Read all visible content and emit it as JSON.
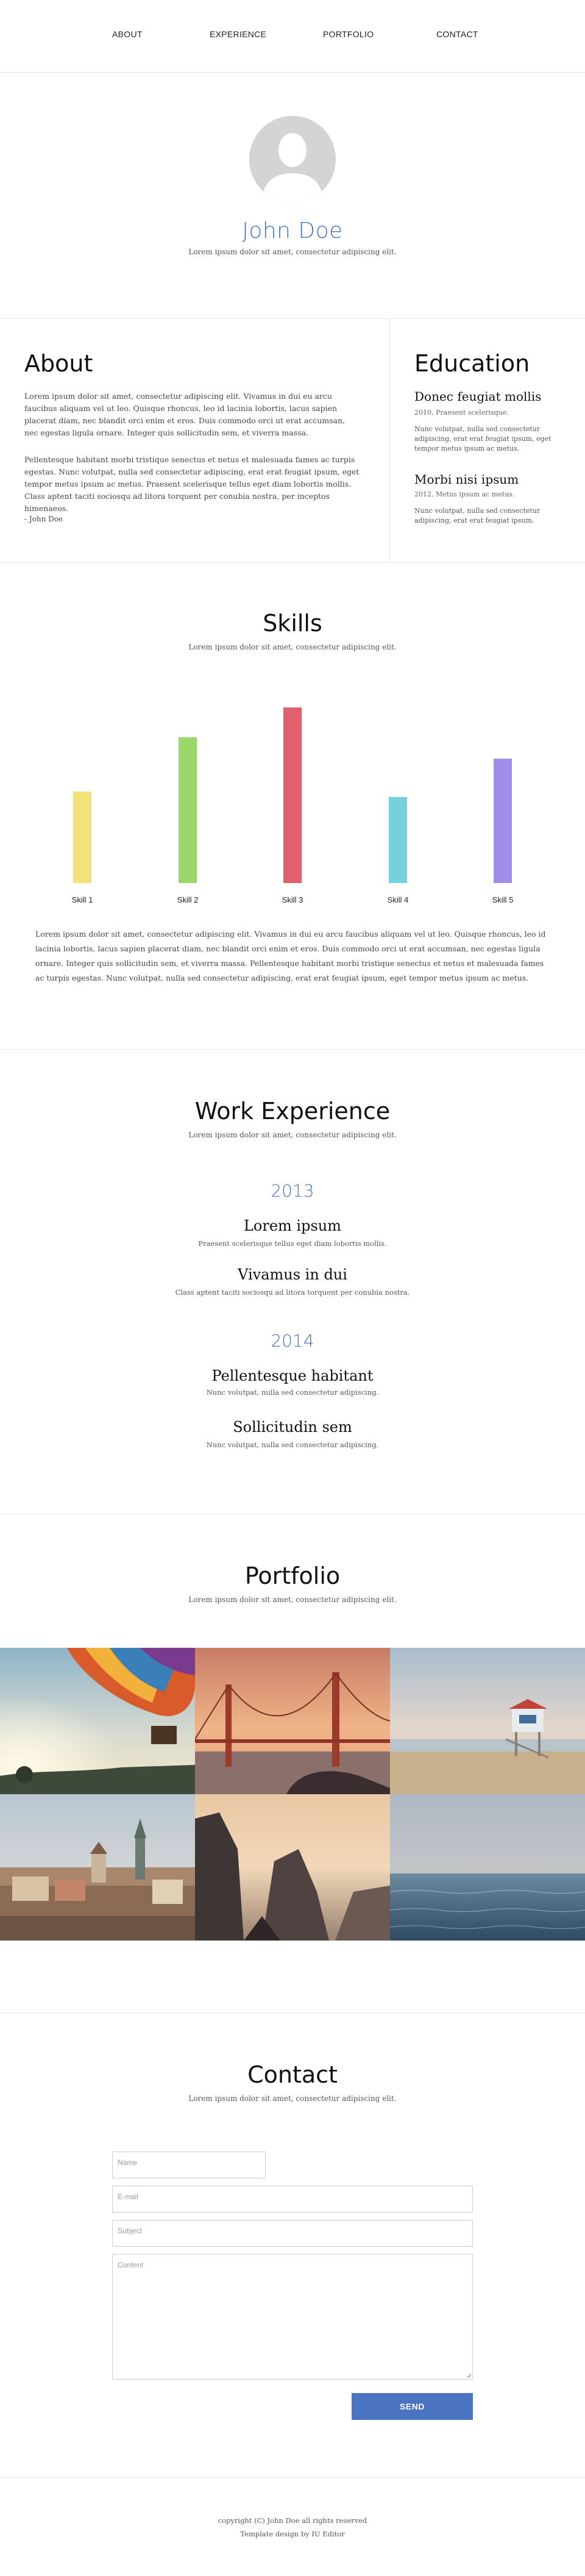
{
  "nav": {
    "items": [
      {
        "label": "ABOUT"
      },
      {
        "label": "EXPERIENCE"
      },
      {
        "label": "PORTFOLIO"
      },
      {
        "label": "CONTACT"
      }
    ]
  },
  "hero": {
    "name": "John Doe",
    "tagline": "Lorem ipsum dolor sit amet, consectetur adipiscing elit."
  },
  "about": {
    "title": "About",
    "paragraphs": [
      "Lorem ipsum dolor sit amet, consectetur adipiscing elit. Vivamus in dui eu arcu faucibus aliquam vel ut leo. Quisque rhoncus, leo id lacinia lobortis, lacus sapien placerat diam, nec blandit orci enim et eros. Duis commodo orci ut erat accumsan, nec egestas ligula ornare. Integer quis sollicitudin sem, et viverra massa.",
      "Pellentesque habitant morbi tristique senectus et netus et malesuada fames ac turpis egestas. Nunc volutpat, nulla sed consectetur adipiscing, erat erat feugiat ipsum, eget tempor metus ipsum ac metus. Praesent scelerisque tellus eget diam lobortis mollis. Class aptent taciti sociosqu ad litora torquent per conubia nostra, per inceptos himenaeos."
    ],
    "signature": "- John Doe"
  },
  "education": {
    "title": "Education",
    "items": [
      {
        "heading": "Donec feugiat mollis",
        "meta": "2010, Praesent scelerisque.",
        "text": "Nunc volutpat, nulla sed consectetur adipiscing, erat erat feugiat ipsum, eget tempor metus ipsum ac metus."
      },
      {
        "heading": "Morbi nisi ipsum",
        "meta": "2012, Metus ipsum ac metus.",
        "text": "Nunc volutpat, nulla sed consectetur adipiscing, erat erat feugiat ipsum."
      }
    ]
  },
  "skills": {
    "title": "Skills",
    "subtitle": "Lorem ipsum dolor sit amet, consectetur adipiscing elit.",
    "paragraph": "Lorem ipsum dolor sit amet, consectetur adipiscing elit. Vivamus in dui eu arcu faucibus aliquam vel ut leo. Quisque rhoncus, leo id lacinia lobortis, lacus sapien placerat diam, nec blandit orci enim et eros. Duis commodo orci ut erat accumsan, nec egestas ligula ornare. Integer quis sollicitudin sem, et viverra massa. Pellentesque habitant morbi tristique senectus et netus et malesuada fames ac turpis egestas. Nunc volutpat, nulla sed consectetur adipiscing, erat erat feugiat ipsum, eget tempor metus ipsum ac metus.",
    "items": [
      {
        "label": "Skill 1",
        "level": 0.52,
        "color": "#f2e27a"
      },
      {
        "label": "Skill 2",
        "level": 0.83,
        "color": "#9ad86a"
      },
      {
        "label": "Skill 3",
        "level": 1.0,
        "color": "#e4606e"
      },
      {
        "label": "Skill 4",
        "level": 0.49,
        "color": "#74d2e0"
      },
      {
        "label": "Skill 5",
        "level": 0.71,
        "color": "#a28ee8"
      }
    ]
  },
  "work": {
    "title": "Work Experience",
    "subtitle": "Lorem ipsum dolor sit amet, consectetur adipiscing elit.",
    "years": [
      {
        "year": "2013",
        "jobs": [
          {
            "title": "Lorem ipsum",
            "desc": "Praesent scelerisque tellus eget diam lobortis mollis."
          },
          {
            "title": "Vivamus in dui",
            "desc": "Class aptent taciti sociosqu ad litora torquent per conubia nostra."
          }
        ]
      },
      {
        "year": "2014",
        "jobs": [
          {
            "title": "Pellentesque habitant",
            "desc": "Nunc volutpat, nulla sed consectetur adipiscing."
          },
          {
            "title": "Sollicitudin sem",
            "desc": "Nunc volutpat, nulla sed consectetur adipiscing."
          }
        ]
      }
    ]
  },
  "portfolio": {
    "title": "Portfolio",
    "subtitle": "Lorem ipsum dolor sit amet, consectetur adipiscing elit."
  },
  "contact": {
    "title": "Contact",
    "subtitle": "Lorem ipsum dolor sit amet, consectetur adipiscing elit.",
    "name_placeholder": "Name",
    "email_placeholder": "E-mail",
    "subject_placeholder": "Subject",
    "content_placeholder": "Content",
    "send_label": "SEND"
  },
  "footer": {
    "copyright": "copyright (C) John Doe all rights reserved",
    "credit": "Template design by IU Editor"
  },
  "colors": {
    "accent": "#4a74c2"
  }
}
